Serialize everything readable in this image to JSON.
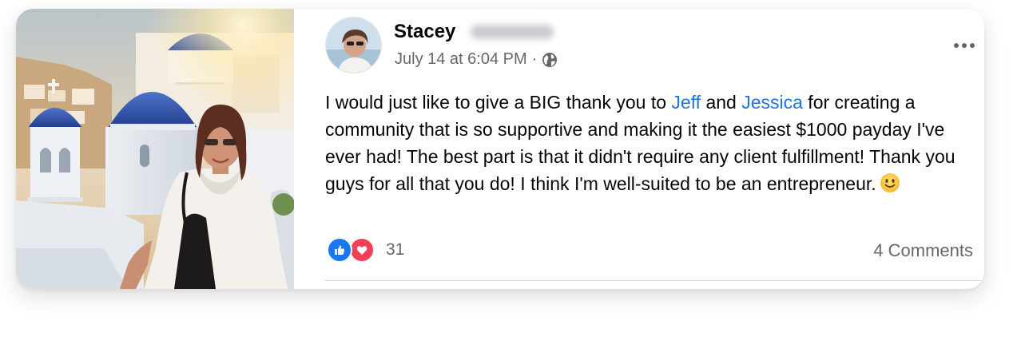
{
  "post": {
    "author_first_name": "Stacey",
    "timestamp": "July 14 at 6:04 PM",
    "meta_separator": "·",
    "privacy_icon": "globe-icon",
    "more_icon": "more-options-icon",
    "text_part1": "I would just like to give a BIG thank you to ",
    "mention1": "Jeff",
    "text_part2": " and ",
    "mention2": "Jessica",
    "text_part3": " for creating a community that is so supportive and making it the easiest $1000 payday I've ever had! The best part is that it didn't require any client fulfillment! Thank you guys for all that you do! I think I'm well-suited to be an entrepreneur.",
    "emoji": "slightly-smiling-face-emoji",
    "reactions": {
      "types": [
        "like-icon",
        "love-icon"
      ],
      "count": "31"
    },
    "comments_label": "4 Comments"
  },
  "colors": {
    "mention": "#1b74e4",
    "like": "#1877f2",
    "love": "#f33e58",
    "secondary_text": "#65676b"
  }
}
